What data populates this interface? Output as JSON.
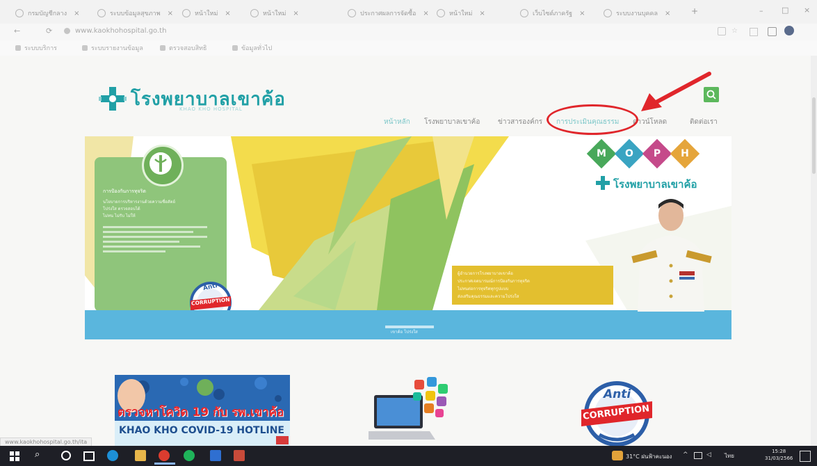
{
  "browser": {
    "tabs": [
      {
        "label": "กรมบัญชีกลาง"
      },
      {
        "label": "ระบบข้อมูลสุขภาพ"
      },
      {
        "label": "หน้าใหม่"
      },
      {
        "label": "หน้าใหม่"
      },
      {
        "label": "ประกาศผลการจัดซื้อ"
      },
      {
        "label": "หน้าใหม่"
      },
      {
        "label": "เว็บไซต์ภาครัฐ"
      },
      {
        "label": "ระบบงานบุคคล"
      }
    ],
    "url": "www.kaokhohospital.go.th",
    "bookmarks": [
      {
        "label": "ระบบบริการ"
      },
      {
        "label": "ระบบรายงานข้อมูล"
      },
      {
        "label": "ตรวจสอบสิทธิ"
      },
      {
        "label": "ข้อมูลทั่วไป"
      }
    ],
    "status_text": "www.kaokhohospital.go.th/ita"
  },
  "site": {
    "logo_text": "โรงพยาบาลเขาค้อ",
    "logo_subtext": "KHAO KHO HOSPITAL",
    "nav": [
      {
        "label": "หน้าหลัก"
      },
      {
        "label": "โรงพยาบาลเขาค้อ"
      },
      {
        "label": "ข่าวสารองค์กร"
      },
      {
        "label": "การประเมินคุณธรรม"
      },
      {
        "label": "ดาวน์โหลด"
      },
      {
        "label": "ติดต่อเรา"
      }
    ],
    "moph_letters": [
      "M",
      "O",
      "P",
      "H"
    ],
    "hero_logo_text": "โรงพยาบาลเขาค้อ",
    "panel_heading": "การป้องกันการทุจริต",
    "panel_lines": [
      "นโยบายการบริหารงานด้วยความซื่อสัตย์",
      "โปร่งใส ตรวจสอบได้",
      "ไม่ทน ไม่รับ ไม่ให้"
    ],
    "yellow_lines": [
      "ผู้อำนวยการโรงพยาบาลเขาค้อ",
      "ประกาศเจตนารมณ์การป้องกันการทุจริต",
      "ไม่ทนต่อการทุจริตทุกรูปแบบ",
      "ส่งเสริมคุณธรรมและความโปร่งใส"
    ],
    "blue_bar_text": "เขาค้อ โปร่งใส",
    "anti_top": "Anti",
    "anti_main": "CORRUPTION",
    "covid_banner_line1": "ตรวจหาโควิด 19 กับ รพ.เขาค้อ",
    "covid_banner_line2": "KHAO KHO COVID-19 HOTLINE"
  },
  "taskbar": {
    "weather": "31°C ฝนฟ้าคะนอง",
    "time": "15:28",
    "date": "31/03/2566",
    "lang": "ไทย"
  },
  "colors": {
    "teal": "#21a0a6",
    "annotation_red": "#e0262b",
    "yellow": "#e3bf2f",
    "green_panel": "#8fc57b",
    "blue_bar": "#5ab6dd"
  }
}
